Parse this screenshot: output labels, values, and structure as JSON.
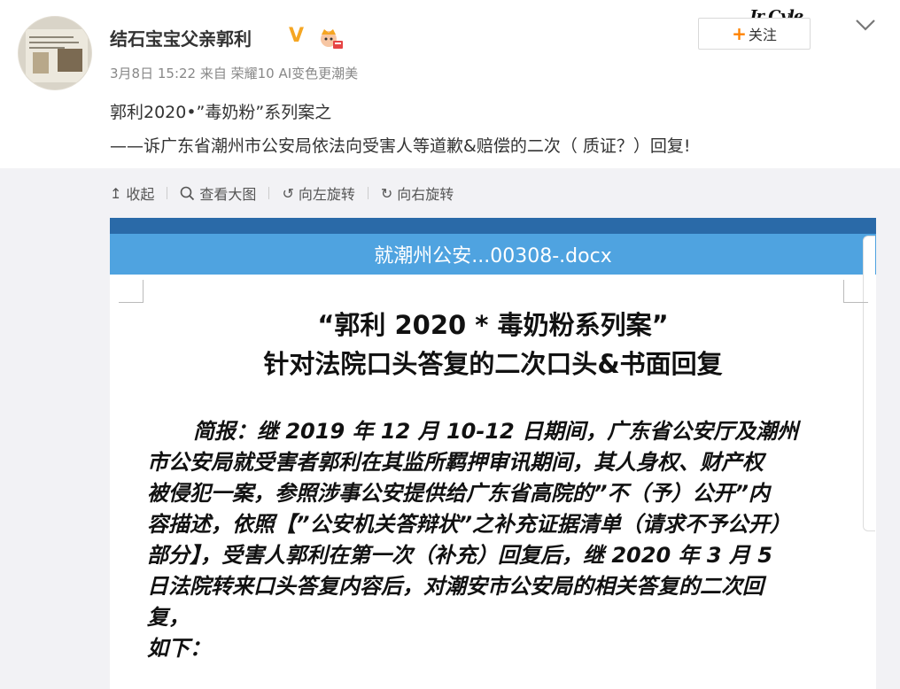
{
  "post": {
    "username": "结石宝宝父亲郭利",
    "vip_badge": "V",
    "meta": "3月8日 15:22 来自 荣耀10 AI变色更潮美",
    "follow_label": "关注",
    "follow_plus": "+",
    "brand_logo": "Jr Cyle",
    "text_line1": "郭利2020•”毒奶粉”系列案之",
    "text_line2": "——诉广东省潮州市公安局依法向受害人等道歉&赔偿的二次（ 质证？）回复!"
  },
  "toolbar": {
    "collapse_label": "收起",
    "view_large_label": "查看大图",
    "rotate_left_label": "向左旋转",
    "rotate_right_label": "向右旋转"
  },
  "document": {
    "filename": "就潮州公安...00308-.docx",
    "title_line1": "“郭利 2020 * 毒奶粉系列案”",
    "title_line2": "针对法院口头答复的二次口头&书面回复",
    "body_lines": [
      "简报：继 2019 年 12 月 10-12 日期间，广东省公安厅及潮州",
      "市公安局就受害者郭利在其监所羁押审讯期间，其人身权、财产权",
      "被侵犯一案，参照涉事公安提供给广东省高院的”不（予）公开”内",
      "容描述，依照【”公安机关答辩状”之补充证据清单（请求不予公开）",
      "部分】，受害人郭利在第一次（补充）回复后，继 2020 年 3 月 5",
      "日法院转来口头答复内容后，对潮安市公安局的相关答复的二次回",
      "复，",
      "如下："
    ]
  },
  "icons": {
    "vip": "vip-v-icon",
    "badge": "crown-badge-icon",
    "chevron": "chevron-down-icon",
    "collapse": "collapse-up-icon",
    "search": "search-icon",
    "rotate_left": "rotate-left-icon",
    "rotate_right": "rotate-right-icon"
  },
  "colors": {
    "accent_orange": "#ff8200",
    "vip_gold": "#f5a623",
    "doc_titlebar": "#4fa3e0",
    "doc_topbar": "#2a6aa8"
  }
}
